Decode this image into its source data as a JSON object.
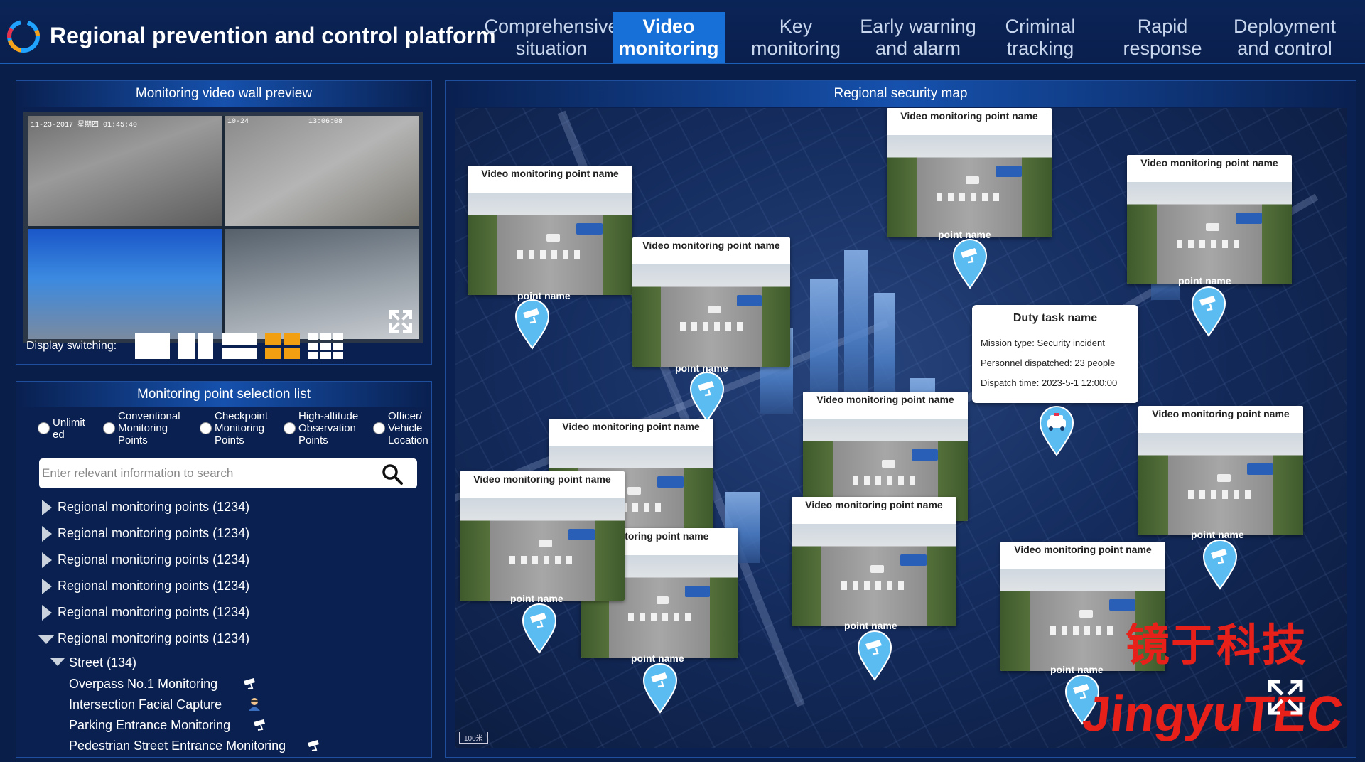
{
  "header": {
    "title": "Regional prevention and control platform",
    "nav": [
      {
        "label": "Comprehensive situation",
        "active": false
      },
      {
        "label": "Video monitoring",
        "active": true
      },
      {
        "label": "Key monitoring",
        "active": false
      },
      {
        "label": "Early warning and alarm",
        "active": false
      },
      {
        "label": "Criminal tracking",
        "active": false
      },
      {
        "label": "Rapid response",
        "active": false
      },
      {
        "label": "Deployment and control",
        "active": false
      }
    ]
  },
  "video_wall": {
    "title": "Monitoring video wall preview",
    "timestamps": [
      "11-23-2017  星期四  01:45:40",
      "10-24",
      "13:06:08"
    ],
    "display_switching_label": "Display switching:",
    "layouts": [
      "1x1",
      "1x2",
      "2x1",
      "2x2",
      "3x3"
    ],
    "active_layout": "2x2",
    "colors": {
      "accent": "#f2a011",
      "default": "#ffffff"
    }
  },
  "point_list": {
    "title": "Monitoring point selection list",
    "filters": [
      "Unlimited",
      "Conventional Monitoring Points",
      "Checkpoint Monitoring Points",
      "High-altitude Observation Points",
      "Officer/ Vehicle Location"
    ],
    "search_placeholder": "Enter relevant information to search",
    "groups": [
      "Regional monitoring points  (1234)",
      "Regional monitoring points  (1234)",
      "Regional monitoring points  (1234)",
      "Regional monitoring points  (1234)",
      "Regional monitoring points  (1234)",
      "Regional monitoring points  (1234)"
    ],
    "subgroup": "Street  (134)",
    "leaves": [
      {
        "label": "Overpass No.1 Monitoring",
        "icon": "camera-icon"
      },
      {
        "label": "Intersection Facial Capture",
        "icon": "face-capture-icon"
      },
      {
        "label": "Parking Entrance Monitoring",
        "icon": "camera-icon"
      },
      {
        "label": "Pedestrian Street Entrance Monitoring",
        "icon": "camera-icon"
      }
    ]
  },
  "map": {
    "title": "Regional security map",
    "card_title": "Video monitoring point name",
    "card_title_partial": "deo monitoring point name",
    "pin_label": "point name",
    "duty": {
      "title": "Duty task name",
      "mission": "Mission type: Security incident",
      "personnel": "Personnel dispatched: 23 people",
      "time": "Dispatch time: 2023-5-1 12:00:00"
    },
    "watermark_cn": "镜于科技",
    "watermark_en": "JingyuTEC",
    "scale": "100米",
    "colors": {
      "pin": "#5bbcf2",
      "watermark": "#e8201a"
    }
  }
}
